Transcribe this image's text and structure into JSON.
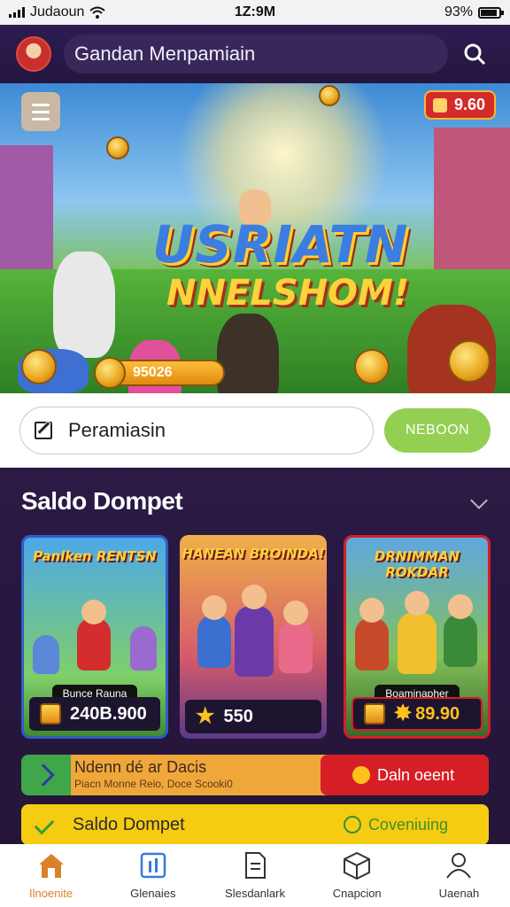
{
  "status": {
    "carrier": "Judaoun",
    "time": "1Z:9M",
    "battery": "93%"
  },
  "header": {
    "search_text": "Gandan Menpamiain"
  },
  "hero": {
    "title_line1": "USRIATN",
    "title_line2": "NNELSHOM!",
    "top_badge": "9.60",
    "coin_amount": "95026"
  },
  "search": {
    "value": "Peramiasin",
    "button_label": "NEBOON"
  },
  "saldo": {
    "title": "Saldo Dompet",
    "cards": [
      {
        "title": "Panlken RENTSN",
        "label": "Bunce Rauna",
        "value": "240B.900"
      },
      {
        "title": "HANEAN BROINDA!",
        "label": "",
        "value": "550"
      },
      {
        "title": "DRNIMMAN ROKDAR",
        "label": "Boaminapher",
        "value": "89.90"
      }
    ],
    "bar1": {
      "title": "Ndenn dé ar Dacis",
      "subtitle": "Piacn Monne Reio, Doce Scooki0",
      "button": "Daln oeent"
    },
    "bar2": {
      "title": "Saldo Dompet",
      "status": "Coveniuing"
    }
  },
  "nav": [
    {
      "label": "Ilnoenite",
      "icon": "home-icon",
      "active": true
    },
    {
      "label": "Glenaies",
      "icon": "chart-icon",
      "active": false
    },
    {
      "label": "Slesdanlark",
      "icon": "document-icon",
      "active": false
    },
    {
      "label": "Cnapcion",
      "icon": "box-icon",
      "active": false
    },
    {
      "label": "Uaenah",
      "icon": "user-icon",
      "active": false
    }
  ],
  "colors": {
    "accent": "#d8832a",
    "green": "#93cf52",
    "red": "#d61e26",
    "yellow": "#f6cc12"
  }
}
